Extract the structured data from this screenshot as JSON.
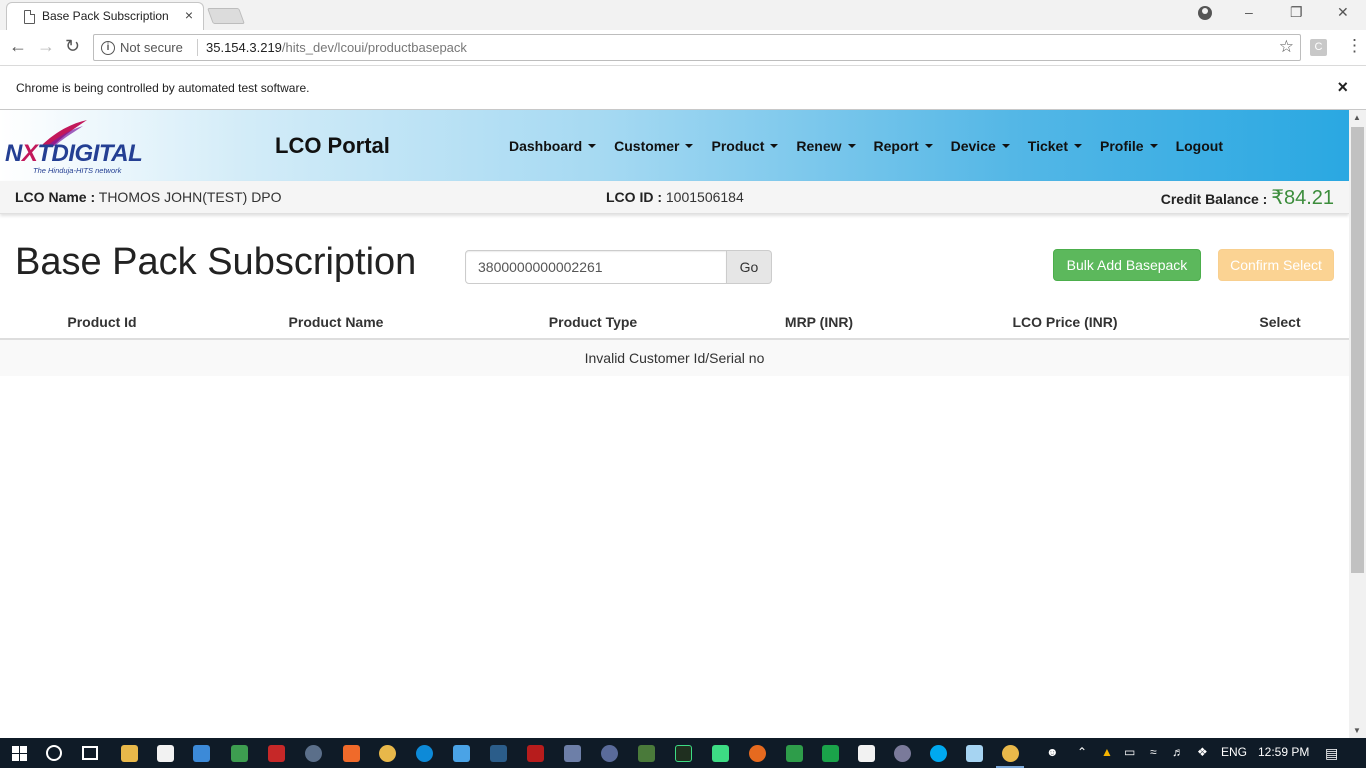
{
  "browser": {
    "tab_title": "Base Pack Subscription",
    "tab_close": "×",
    "not_secure": "Not secure",
    "url_host": "35.154.3.219",
    "url_path": "/hits_dev/lcoui/productbasepack",
    "infobar_text": "Chrome is being controlled by automated test software.",
    "infobar_close": "×",
    "ext_label": "C"
  },
  "header": {
    "logo_text_a": "N",
    "logo_text_b": "X",
    "logo_text_c": "T",
    "logo_text_d": "DIGITAL",
    "logo_sub": "The Hinduja-HITS network",
    "portal_title": "LCO Portal",
    "nav": [
      {
        "label": "Dashboard"
      },
      {
        "label": "Customer"
      },
      {
        "label": "Product"
      },
      {
        "label": "Renew"
      },
      {
        "label": "Report"
      },
      {
        "label": "Device"
      },
      {
        "label": "Ticket"
      },
      {
        "label": "Profile"
      },
      {
        "label": "Logout"
      }
    ]
  },
  "lco": {
    "name_label": "LCO Name :",
    "name_value": "THOMOS JOHN(TEST) DPO",
    "id_label": "LCO ID :",
    "id_value": "1001506184",
    "credit_label": "Credit Balance :",
    "credit_value": "₹84.21"
  },
  "content": {
    "heading": "Base Pack Subscription",
    "search_value": "3800000000002261",
    "go_label": "Go",
    "bulk_label": "Bulk Add Basepack",
    "confirm_label": "Confirm Select",
    "columns": [
      "Product Id",
      "Product Name",
      "Product Type",
      "MRP (INR)",
      "LCO Price (INR)",
      "Select"
    ],
    "empty_message": "Invalid Customer Id/Serial no"
  },
  "taskbar": {
    "lang": "ENG",
    "time": "12:59 PM"
  },
  "colors": {
    "success": "#5cb85c",
    "warning_disabled": "#fbd393",
    "credit_green": "#3c8d3c",
    "header_blue": "#2aa8e2"
  }
}
